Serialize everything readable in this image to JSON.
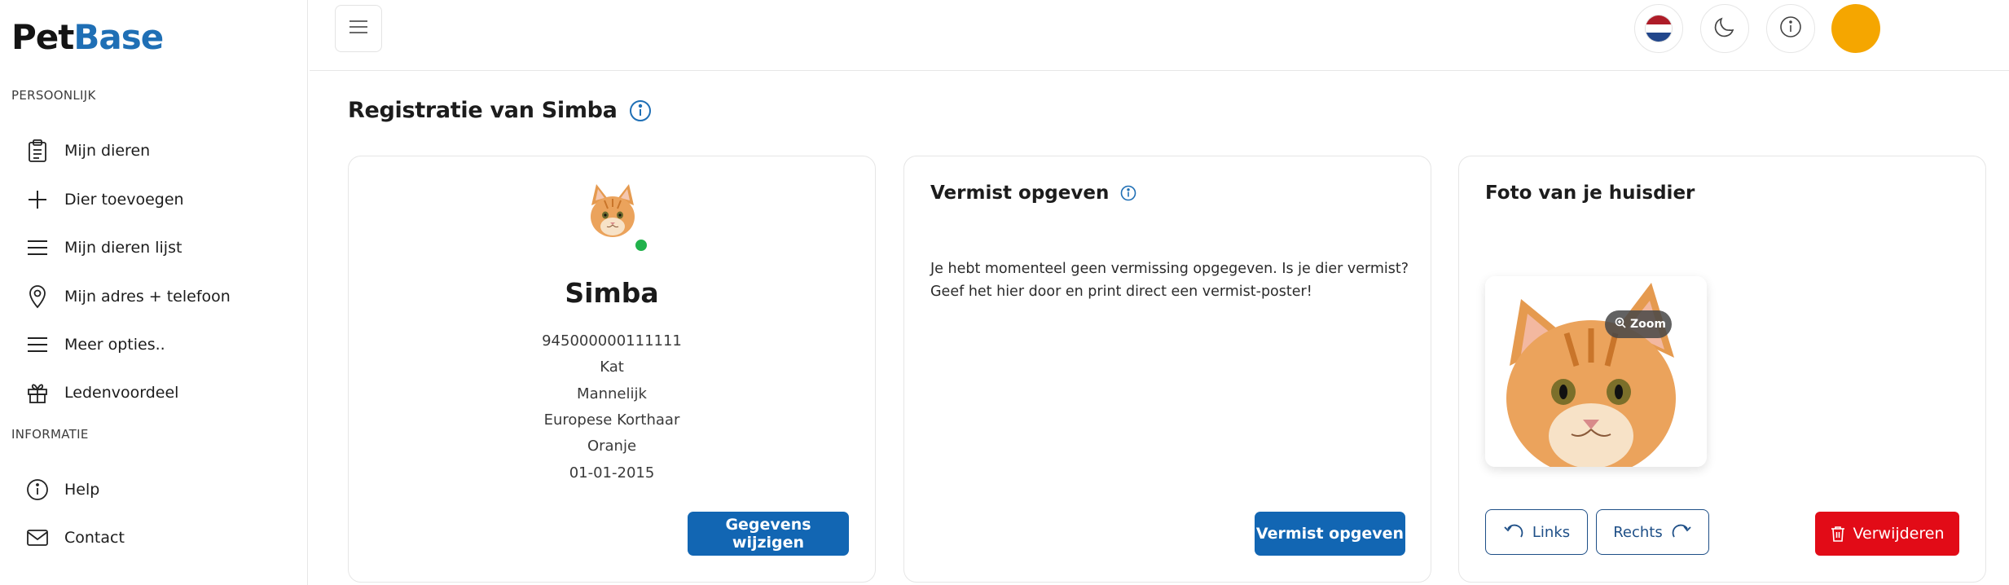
{
  "brand": {
    "logo_part1": "Pet",
    "logo_part2": "Base"
  },
  "sidebar": {
    "section_personal": "PERSOONLIJK",
    "section_info": "INFORMATIE",
    "items": [
      {
        "label": "Mijn dieren",
        "icon": "clipboard-icon"
      },
      {
        "label": "Dier toevoegen",
        "icon": "plus-icon"
      },
      {
        "label": "Mijn dieren lijst",
        "icon": "list-icon"
      },
      {
        "label": "Mijn adres + telefoon",
        "icon": "location-pin-icon"
      },
      {
        "label": "Meer opties..",
        "icon": "menu-icon"
      },
      {
        "label": "Ledenvoordeel",
        "icon": "gift-icon"
      }
    ],
    "info_items": [
      {
        "label": "Help",
        "icon": "info-icon"
      },
      {
        "label": "Contact",
        "icon": "mail-icon"
      }
    ]
  },
  "topbar": {
    "flag_colors": [
      "#ae1c28",
      "#ffffff",
      "#21468b"
    ],
    "avatar_color": "#f5a600"
  },
  "page": {
    "title": "Registratie van Simba"
  },
  "pet_card": {
    "name": "Simba",
    "chip_number": "945000000111111",
    "species": "Kat",
    "gender": "Mannelijk",
    "breed": "Europese Korthaar",
    "color": "Oranje",
    "birth_date": "01-01-2015",
    "status_color": "#21b24b",
    "edit_button": "Gegevens wijzigen"
  },
  "missing_card": {
    "title": "Vermist opgeven",
    "text": "Je hebt momenteel geen vermissing opgegeven. Is je dier vermist? Geef het hier door en print direct een vermist-poster!",
    "button": "Vermist opgeven"
  },
  "photo_card": {
    "title": "Foto van je huisdier",
    "zoom_label": "Zoom",
    "rotate_left": "Links",
    "rotate_right": "Rechts",
    "delete_button": "Verwijderen"
  },
  "colors": {
    "primary": "#1266b3",
    "danger": "#e20b17",
    "accent_blue": "#1f6fb5"
  }
}
